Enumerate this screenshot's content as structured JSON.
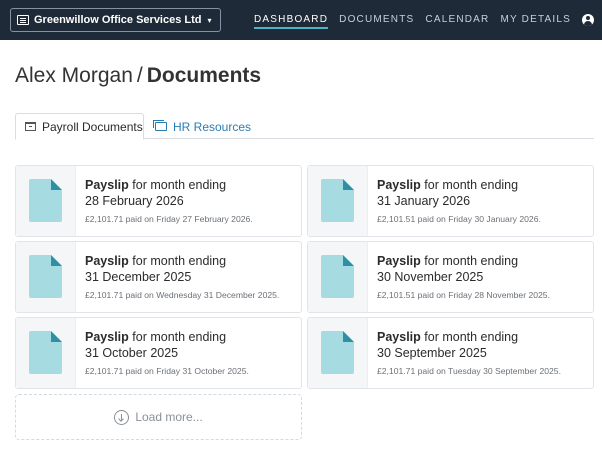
{
  "header": {
    "org_name": "Greenwillow Office Services Ltd",
    "nav": [
      "DASHBOARD",
      "DOCUMENTS",
      "CALENDAR",
      "MY DETAILS"
    ],
    "active_nav": "DASHBOARD"
  },
  "page": {
    "user_name": "Alex Morgan",
    "separator": "/",
    "section": "Documents"
  },
  "tabs": {
    "payroll": "Payroll Documents",
    "hr": "HR Resources"
  },
  "documents": [
    {
      "type": "Payslip",
      "title_suffix": "for month ending",
      "date": "28 February 2026",
      "paid": "£2,101.71 paid on Friday 27 February 2026."
    },
    {
      "type": "Payslip",
      "title_suffix": "for month ending",
      "date": "31 January 2026",
      "paid": "£2,101.51 paid on Friday 30 January 2026."
    },
    {
      "type": "Payslip",
      "title_suffix": "for month ending",
      "date": "31 December 2025",
      "paid": "£2,101.71 paid on Wednesday 31 December 2025."
    },
    {
      "type": "Payslip",
      "title_suffix": "for month ending",
      "date": "30 November 2025",
      "paid": "£2,101.51 paid on Friday 28 November 2025."
    },
    {
      "type": "Payslip",
      "title_suffix": "for month ending",
      "date": "31 October 2025",
      "paid": "£2,101.71 paid on Friday 31 October 2025."
    },
    {
      "type": "Payslip",
      "title_suffix": "for month ending",
      "date": "30 September 2025",
      "paid": "£2,101.71 paid on Tuesday 30 September 2025."
    }
  ],
  "load_more": "Load more...",
  "colors": {
    "topbar": "#1f2a38",
    "accent": "#4fb3c7",
    "link": "#2a7db4",
    "doc_icon": "#a6dbe2"
  }
}
